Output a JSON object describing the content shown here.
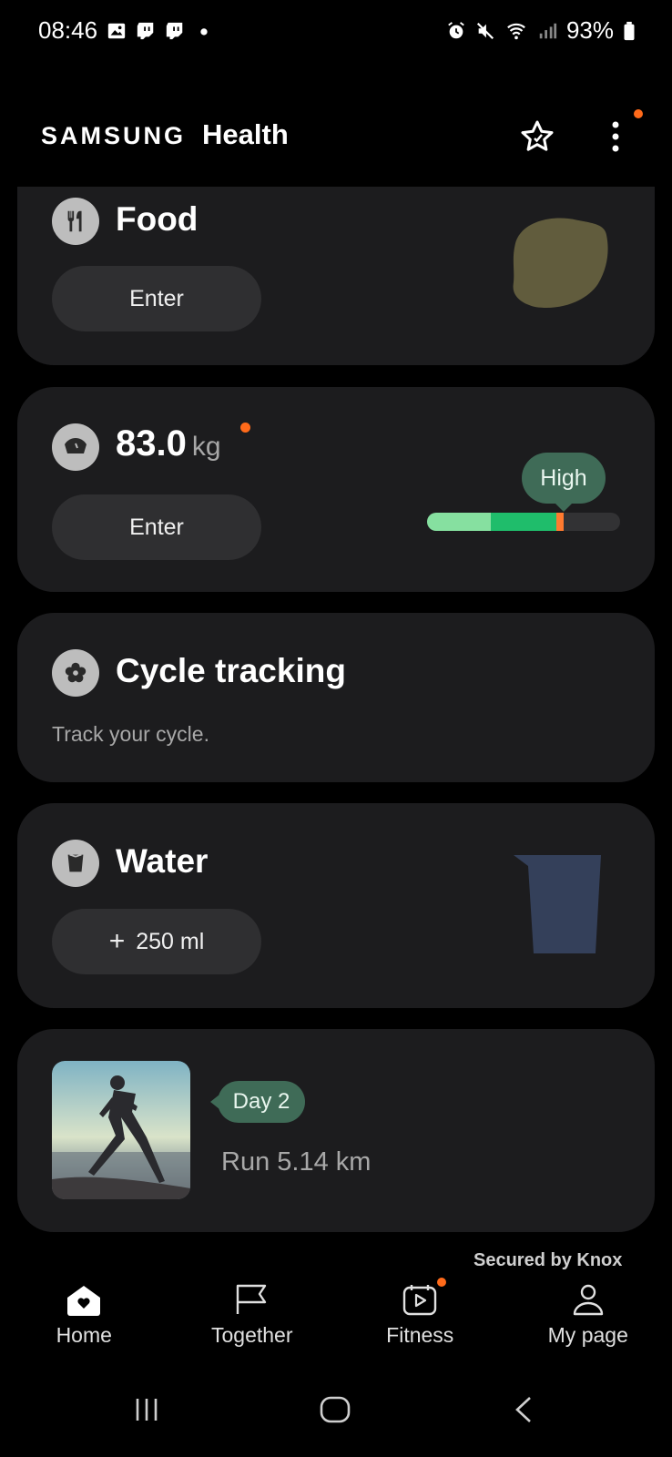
{
  "status_bar": {
    "time": "08:46",
    "battery": "93%",
    "left_icons": [
      "gallery-icon",
      "twitch-icon",
      "twitch-icon",
      "dot"
    ],
    "right_icons": [
      "alarm-icon",
      "mute-icon",
      "wifi-icon",
      "signal-icon",
      "battery-icon"
    ]
  },
  "header": {
    "brand_samsung": "SAMSUNG",
    "brand_health": "Health",
    "actions": [
      "star-icon",
      "more-icon"
    ]
  },
  "cards": {
    "food": {
      "title": "Food",
      "button": "Enter"
    },
    "weight": {
      "value": "83.0",
      "unit": "kg",
      "button": "Enter",
      "level_label": "High"
    },
    "cycle": {
      "title": "Cycle tracking",
      "subtitle": "Track your cycle."
    },
    "water": {
      "title": "Water",
      "button_icon": "+",
      "button_label": "250 ml"
    },
    "fitness": {
      "badge": "Day 2",
      "text": "Run 5.14 km"
    }
  },
  "footer": {
    "knox": "Secured by Knox"
  },
  "bottom_nav": [
    {
      "label": "Home",
      "icon": "home-icon"
    },
    {
      "label": "Together",
      "icon": "flag-icon"
    },
    {
      "label": "Fitness",
      "icon": "play-calendar-icon"
    },
    {
      "label": "My page",
      "icon": "person-icon"
    }
  ],
  "colors": {
    "card_bg": "#1c1c1e",
    "accent_orange": "#ff6a1a",
    "bubble_green": "#3f6b57",
    "meter_light": "#86e0a0",
    "meter_green": "#1fbd6b"
  }
}
